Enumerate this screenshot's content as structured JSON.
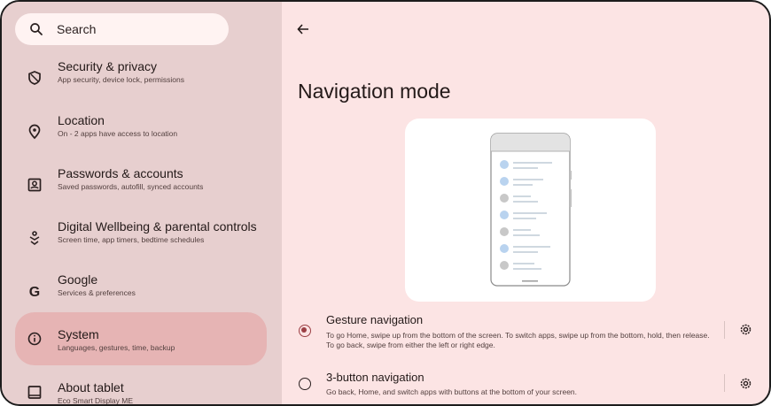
{
  "sidebar": {
    "search_label": "Search",
    "items": [
      {
        "title": "Security & privacy",
        "subtitle": "App security, device lock, permissions",
        "icon": "shield-icon"
      },
      {
        "title": "Location",
        "subtitle": "On - 2 apps have access to location",
        "icon": "location-pin-icon"
      },
      {
        "title": "Passwords & accounts",
        "subtitle": "Saved passwords, autofill, synced accounts",
        "icon": "account-box-icon"
      },
      {
        "title": "Digital Wellbeing & parental controls",
        "subtitle": "Screen time, app timers, bedtime schedules",
        "icon": "wellbeing-icon"
      },
      {
        "title": "Google",
        "subtitle": "Services & preferences",
        "icon": "google-g-icon"
      },
      {
        "title": "System",
        "subtitle": "Languages, gestures, time, backup",
        "icon": "info-icon",
        "selected": true
      },
      {
        "title": "About tablet",
        "subtitle": "Eco Smart Display ME",
        "icon": "tablet-icon"
      }
    ]
  },
  "main": {
    "title": "Navigation mode",
    "options": [
      {
        "title": "Gesture navigation",
        "description": "To go Home, swipe up from the bottom of the screen. To switch apps, swipe up from the bottom, hold, then release. To go back, swipe from either the left or right edge.",
        "selected": true
      },
      {
        "title": "3-button navigation",
        "description": "Go back, Home, and switch apps with buttons at the bottom of your screen.",
        "selected": false
      }
    ]
  },
  "colors": {
    "sidebar_bg": "#e7cfcf",
    "main_bg": "#fce4e4",
    "selected_item_bg": "#e6b4b4",
    "accent": "#9c4045"
  }
}
